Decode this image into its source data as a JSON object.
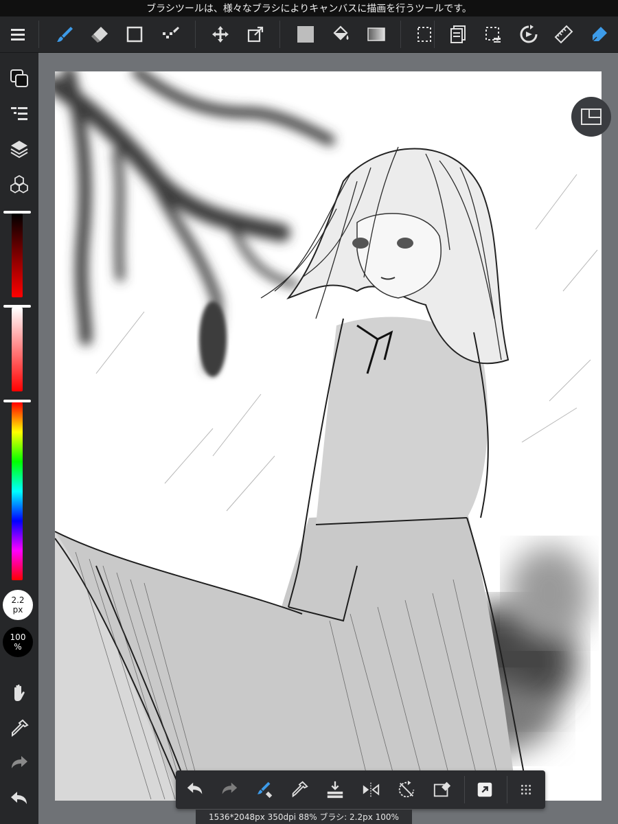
{
  "hint_text": "ブラシツールは、様々なブラシによりキャンバスに描画を行うツールです。",
  "colors": {
    "accent": "#3d9be9",
    "panel": "#262729",
    "workspace": "#6f7276",
    "canvas": "#ffffff"
  },
  "toolbar": {
    "icons": [
      "menu-icon",
      "brush-icon",
      "eraser-icon",
      "shape-icon",
      "dot-icon",
      "move-icon",
      "transform-icon",
      "fill-color-icon",
      "bucket-icon",
      "gradation-icon",
      "select-icon",
      "copy-layer-icon",
      "select-layer-icon",
      "rotate-canvas-icon",
      "ruler-icon",
      "pen-icon"
    ],
    "active": "brush-icon"
  },
  "sidebar": {
    "icons": [
      "color-icon",
      "brush-list-icon",
      "layers-icon",
      "materials-icon",
      "hand-icon",
      "eyedropper-icon",
      "redo-icon",
      "undo-icon"
    ],
    "brush_size": {
      "value": "2.2",
      "unit": "px"
    },
    "opacity": {
      "value": "100",
      "unit": "%"
    }
  },
  "bottom_toolbar": {
    "icons": [
      "undo-icon",
      "redo-icon",
      "brush-eraser-toggle-icon",
      "eyedropper-icon",
      "layer-transfer-icon",
      "flip-icon",
      "rotate-reset-icon",
      "clear-layer-icon",
      "export-icon",
      "more-icon"
    ]
  },
  "status": "1536*2048px 350dpi 88% ブラシ: 2.2px 100%"
}
